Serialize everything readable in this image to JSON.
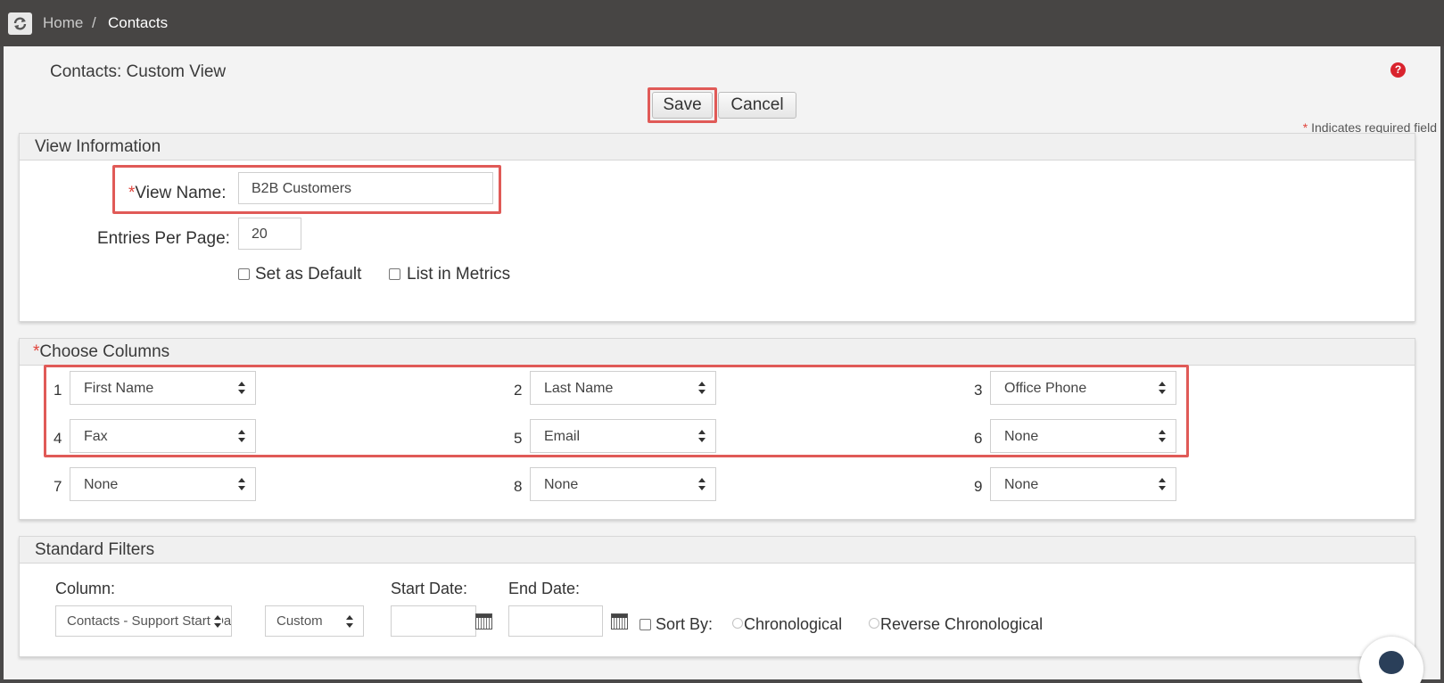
{
  "topbar": {
    "breadcrumb_home": "Home",
    "breadcrumb_separator": "/",
    "breadcrumb_current": "Contacts"
  },
  "page": {
    "title": "Contacts: Custom View",
    "help_glyph": "?",
    "save_label": "Save",
    "cancel_label": "Cancel",
    "required_star": "*",
    "required_note": "Indicates required field"
  },
  "view_info": {
    "header": "View Information",
    "view_name_star": "*",
    "view_name_label": "View Name:",
    "view_name_value": "B2B Customers",
    "entries_label": "Entries Per Page:",
    "entries_value": "20",
    "set_default_label": "Set as Default",
    "list_metrics_label": "List in Metrics"
  },
  "choose_columns": {
    "header_star": "*",
    "header": "Choose Columns",
    "columns": [
      {
        "num": "1",
        "value": "First Name"
      },
      {
        "num": "2",
        "value": "Last Name"
      },
      {
        "num": "3",
        "value": "Office Phone"
      },
      {
        "num": "4",
        "value": "Fax"
      },
      {
        "num": "5",
        "value": "Email"
      },
      {
        "num": "6",
        "value": "None"
      },
      {
        "num": "7",
        "value": "None"
      },
      {
        "num": "8",
        "value": "None"
      },
      {
        "num": "9",
        "value": "None"
      }
    ]
  },
  "standard_filters": {
    "header": "Standard Filters",
    "column_label": "Column:",
    "column_value": "Contacts - Support Start Date",
    "range_value": "Custom",
    "start_date_label": "Start Date:",
    "end_date_label": "End Date:",
    "sort_by_label": "Sort By:",
    "chronological_label": "Chronological",
    "reverse_chronological_label": "Reverse Chronological"
  },
  "colors": {
    "topbar": "#474544",
    "highlight": "#e05a57",
    "required": "#e0443c",
    "help": "#d9232d"
  }
}
